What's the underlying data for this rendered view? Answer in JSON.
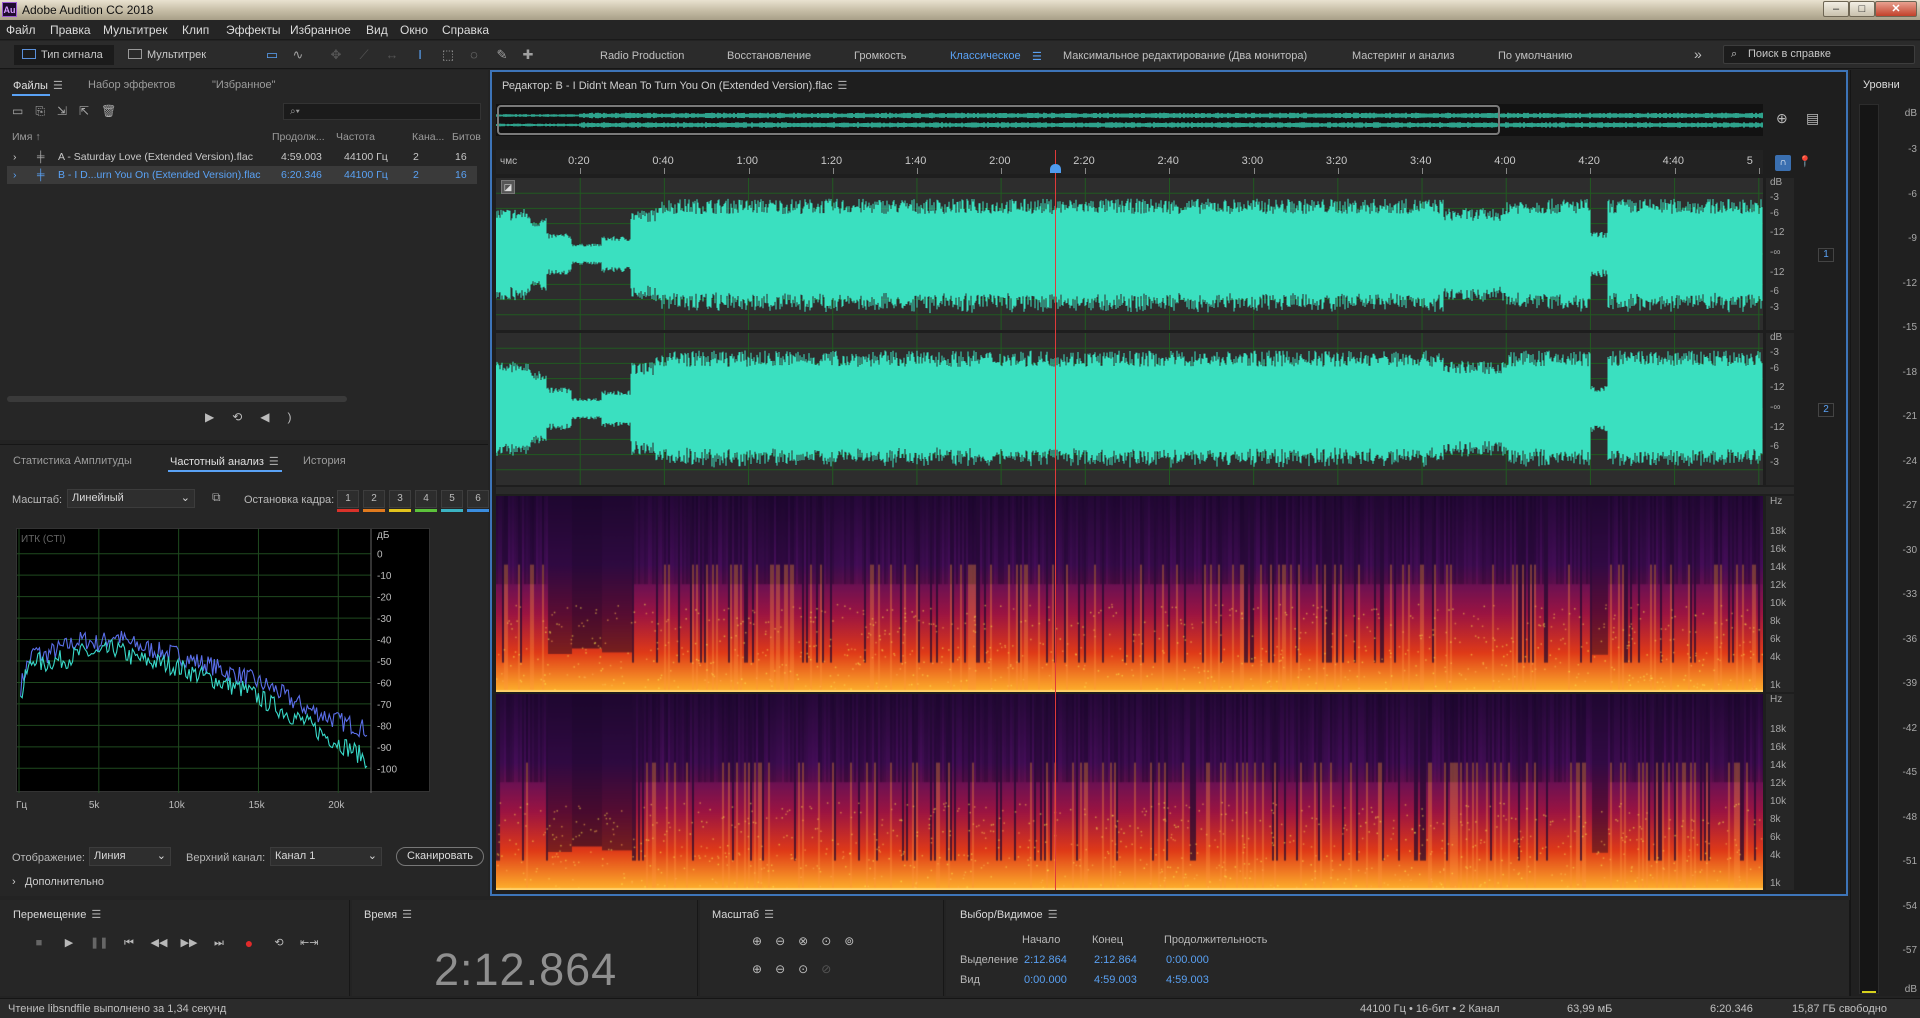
{
  "window": {
    "title": "Adobe Audition CC 2018",
    "logo": "Au"
  },
  "menu": [
    "Файл",
    "Правка",
    "Мультитрек",
    "Клип",
    "Эффекты",
    "Избранное",
    "Вид",
    "Окно",
    "Справка"
  ],
  "toolbar": {
    "mode_waveform": "Тип сигнала",
    "mode_multitrack": "Мультитрек",
    "workspaces": [
      "Radio Production",
      "Восстановление",
      "Громкость",
      "Классическое",
      "Максимальное редактирование (Два монитора)",
      "Мастеринг и анализ",
      "По умолчанию"
    ],
    "active_workspace": "Классическое",
    "help_placeholder": "Поиск в справке"
  },
  "files_panel": {
    "tabs": [
      "Файлы",
      "Набор эффектов",
      "\"Избранное\""
    ],
    "columns": [
      "Имя ↑",
      "Продолж...",
      "Частота",
      "Кана...",
      "Битов"
    ],
    "rows": [
      {
        "name": "A - Saturday Love (Extended Version).flac",
        "duration": "4:59.003",
        "rate": "44100 Гц",
        "channels": "2",
        "bits": "16"
      },
      {
        "name": "B - I D...urn You On (Extended Version).flac",
        "duration": "6:20.346",
        "rate": "44100 Гц",
        "channels": "2",
        "bits": "16"
      }
    ]
  },
  "analysis_panel": {
    "tabs": [
      "Статистика Амплитуды",
      "Частотный анализ",
      "История"
    ],
    "scale_label": "Масштаб:",
    "scale_value": "Линейный",
    "freeze_label": "Остановка кадра:",
    "freeze_buttons": [
      "1",
      "2",
      "3",
      "4",
      "5",
      "6"
    ],
    "freeze_colors": [
      "#d9322a",
      "#e17a1e",
      "#e2c31d",
      "#5cc23b",
      "#3bb3c2",
      "#3a8ddf"
    ],
    "graph_label": "ИТК (CTI)",
    "display_label": "Отображение:",
    "display_value": "Линия",
    "channel_label": "Верхний канал:",
    "channel_value": "Канал 1",
    "scan_button": "Сканировать",
    "advanced": "Дополнительно"
  },
  "chart_data": {
    "type": "line",
    "xlabel": "Гц",
    "ylabel": "дБ",
    "x_ticks": [
      "Гц",
      "5k",
      "10k",
      "15k",
      "20k"
    ],
    "y_ticks": [
      "дБ",
      "0",
      "-10",
      "-20",
      "-30",
      "-40",
      "-50",
      "-60",
      "-70",
      "-80",
      "-90",
      "-100"
    ],
    "xlim": [
      0,
      22050
    ],
    "ylim": [
      -105,
      5
    ],
    "series": [
      {
        "color": "#5a6ee8",
        "x": [
          100,
          500,
          1000,
          1500,
          2000,
          3000,
          4000,
          5000,
          6000,
          7000,
          8000,
          9000,
          10000,
          11000,
          12000,
          13000,
          14000,
          15000,
          16000,
          17000,
          18000,
          19000,
          20000,
          21000,
          21800
        ],
        "y": [
          -62,
          -52,
          -45,
          -48,
          -46,
          -43,
          -40,
          -42,
          -38,
          -42,
          -44,
          -46,
          -47,
          -50,
          -52,
          -55,
          -57,
          -60,
          -63,
          -68,
          -72,
          -75,
          -78,
          -80,
          -82
        ]
      },
      {
        "color": "#38d8c8",
        "x": [
          100,
          500,
          1000,
          1500,
          2000,
          3000,
          4000,
          5000,
          6000,
          7000,
          8000,
          9000,
          10000,
          11000,
          12000,
          13000,
          14000,
          15000,
          16000,
          17000,
          18000,
          19000,
          20000,
          21000,
          21800
        ],
        "y": [
          -68,
          -55,
          -48,
          -52,
          -50,
          -49,
          -46,
          -47,
          -44,
          -48,
          -50,
          -51,
          -53,
          -56,
          -58,
          -61,
          -63,
          -67,
          -71,
          -75,
          -79,
          -84,
          -88,
          -92,
          -96
        ]
      }
    ]
  },
  "editor": {
    "title": "Редактор: B - I Didn't Mean To Turn You On (Extended Version).flac",
    "ruler_unit": "чмс",
    "ruler_ticks": [
      "0:20",
      "0:40",
      "1:00",
      "1:20",
      "1:40",
      "2:00",
      "2:20",
      "2:40",
      "3:00",
      "3:20",
      "3:40",
      "4:00",
      "4:20",
      "4:40",
      "5"
    ],
    "db_labels": [
      "dB",
      "-3",
      "-6",
      "-12",
      "-∞",
      "-12",
      "-6",
      "-3"
    ],
    "hz_labels": [
      "Hz",
      "18k",
      "16k",
      "14k",
      "12k",
      "10k",
      "8k",
      "6k",
      "4k",
      "1k"
    ],
    "channel_badges": [
      "1",
      "2"
    ],
    "playhead_time_sec": 132.864,
    "visible_duration_sec": 301
  },
  "meter": {
    "title": "Уровни",
    "scale": [
      "dB",
      "-3",
      "-6",
      "-9",
      "-12",
      "-15",
      "-18",
      "-21",
      "-24",
      "-27",
      "-30",
      "-33",
      "-36",
      "-39",
      "-42",
      "-45",
      "-48",
      "-51",
      "-54",
      "-57",
      "dB"
    ]
  },
  "transport": {
    "title": "Перемещение"
  },
  "time": {
    "title": "Время",
    "value": "2:12.864"
  },
  "zoom": {
    "title": "Масштаб"
  },
  "selection": {
    "title": "Выбор/Видимое",
    "headers": [
      "Начало",
      "Конец",
      "Продолжительность"
    ],
    "rows": [
      {
        "label": "Выделение",
        "start": "2:12.864",
        "end": "2:12.864",
        "dur": "0:00.000"
      },
      {
        "label": "Вид",
        "start": "0:00.000",
        "end": "4:59.003",
        "dur": "4:59.003"
      }
    ]
  },
  "status": {
    "message": "Чтение libsndfile выполнено за 1,34 секунд",
    "format": "44100 Гц • 16-бит • 2 Канал",
    "size": "63,99 мБ",
    "duration": "6:20.346",
    "free": "15,87 ГБ свободно"
  },
  "colors": {
    "waveform": "#3ae0c0",
    "accent": "#4f9cf0",
    "playhead": "#e03a3a"
  }
}
